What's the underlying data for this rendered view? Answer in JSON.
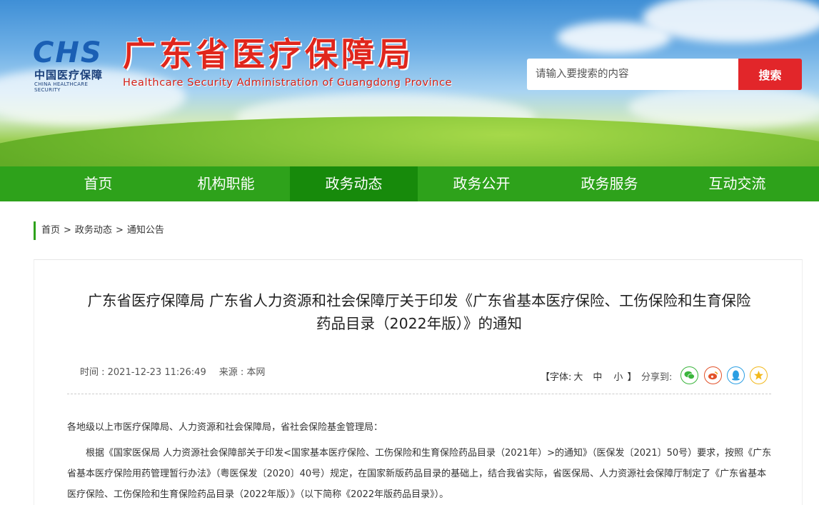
{
  "header": {
    "logo_mark": "CHS",
    "logo_cn": "中国医疗保障",
    "logo_en": "CHINA HEALTHCARE SECURITY",
    "title": "广东省医疗保障局",
    "subtitle": "Healthcare Security Administration of Guangdong Province",
    "search_placeholder": "请输入要搜索的内容",
    "search_button": "搜索"
  },
  "nav": {
    "items": [
      "首页",
      "机构职能",
      "政务动态",
      "政务公开",
      "政务服务",
      "互动交流"
    ],
    "active_index": 2
  },
  "breadcrumb": [
    "首页",
    "政务动态",
    "通知公告"
  ],
  "article": {
    "title_line1": "广东省医疗保障局 广东省人力资源和社会保障厅关于印发《广东省基本医疗保险、工伤保险和生育保险",
    "title_line2": "药品目录（2022年版）》的通知",
    "time": "时间 : 2021-12-23 11:26:49",
    "source": "来源 : 本网",
    "font_label": "【字体:",
    "font_large": "大",
    "font_medium": "中",
    "font_small": "小",
    "font_close": "】",
    "share_label": "分享到:",
    "share_icons": [
      "wechat-icon",
      "weibo-icon",
      "qq-icon",
      "qzone-icon"
    ],
    "para1": "各地级以上市医疗保障局、人力资源和社会保障局，省社会保险基金管理局：",
    "para2": "根据《国家医保局 人力资源社会保障部关于印发<国家基本医疗保险、工伤保险和生育保险药品目录（2021年）>的通知》（医保发〔2021〕50号）要求，按照《广东省基本医疗保险用药管理暂行办法》（粤医保发〔2020〕40号）规定，在国家新版药品目录的基础上，结合我省实际，省医保局、人力资源社会保障厅制定了《广东省基本医疗保险、工伤保险和生育保险药品目录（2022年版）》（以下简称《2022年版药品目录》）。"
  },
  "colors": {
    "nav_green": "#2ea21b",
    "nav_active": "#178a0b",
    "title_red": "#e0261c",
    "search_red": "#e2262a",
    "wechat": "#3bb53d",
    "weibo": "#e2522a",
    "qq": "#2b9fe3",
    "qzone": "#f2b81c"
  }
}
